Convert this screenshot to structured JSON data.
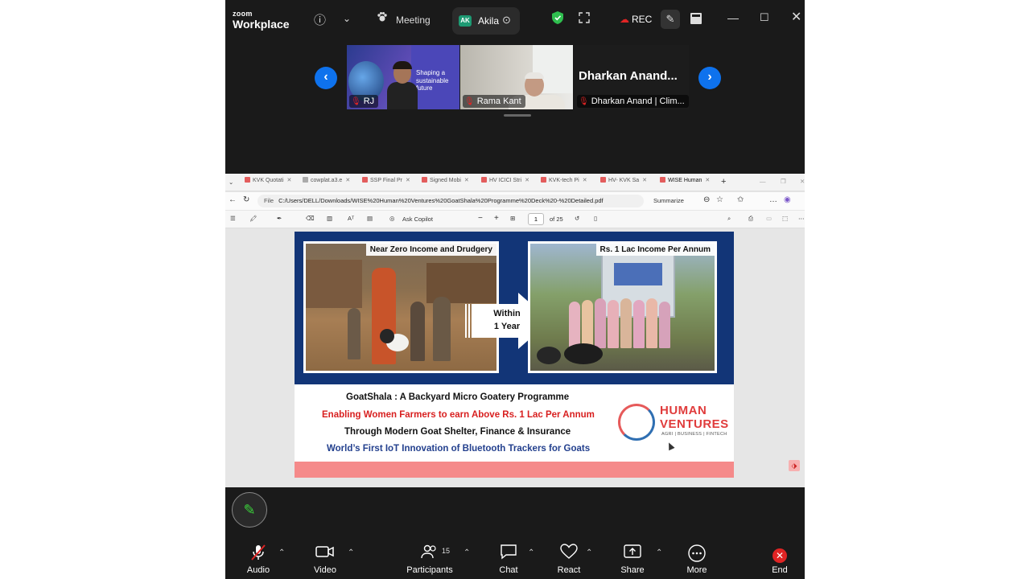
{
  "app": {
    "logo_top": "zoom",
    "logo_bottom": "Workplace",
    "meeting_label": "Meeting",
    "presenter_initials": "AK",
    "presenter_name": "Akila",
    "rec_label": "REC"
  },
  "participants": [
    {
      "name": "RJ",
      "banner": "Shaping a sustainable future"
    },
    {
      "name": "Rama Kant"
    },
    {
      "display": "Dharkan Anand...",
      "name": "Dharkan Anand | Clim..."
    }
  ],
  "browser": {
    "tabs": [
      "KVK Quotati",
      "cowplat.a3.e",
      "SSP Final Pr",
      "Signed Mobi",
      "HV ICICI Stri",
      "KVK-tech Pi",
      "HV- KVK Sa",
      "WISE Human"
    ],
    "file_label": "File",
    "url": "C:/Users/DELL/Downloads/WISE%20Human%20Ventures%20GoatShala%20Programme%20Deck%20-%20Detailed.pdf",
    "summarize": "Summarize",
    "ask_copilot": "Ask Copilot",
    "page_current": "1",
    "page_total": "of 25"
  },
  "slide": {
    "caption_left": "Near Zero Income and Drudgery",
    "caption_right": "Rs. 1 Lac Income Per Annum",
    "arrow_line1": "Within",
    "arrow_line2": "1 Year",
    "line1": "GoatShala : A Backyard Micro Goatery Programme",
    "line2": "Enabling Women Farmers to earn Above Rs. 1 Lac Per Annum",
    "line3": "Through Modern Goat Shelter, Finance & Insurance",
    "line4": "World’s First IoT Innovation of Bluetooth Trackers for Goats",
    "brand_line1": "HUMAN",
    "brand_line2": "VENTURES",
    "brand_tag": "AGRI | BUSINESS | FINTECH"
  },
  "toolbar": {
    "audio": "Audio",
    "video": "Video",
    "participants": "Participants",
    "participant_count": "15",
    "chat": "Chat",
    "react": "React",
    "share": "Share",
    "more": "More",
    "end": "End"
  },
  "icons": {
    "record": "record-dot-icon",
    "security": "shield-icon",
    "annotate": "pencil-icon"
  },
  "colors": {
    "zoom_blue": "#0e72ed",
    "record_red": "#e02424",
    "slide_navy": "#123577",
    "slide_red": "#d81f1f",
    "slide_blue": "#23408e",
    "slide_pink": "#f58a8a"
  }
}
